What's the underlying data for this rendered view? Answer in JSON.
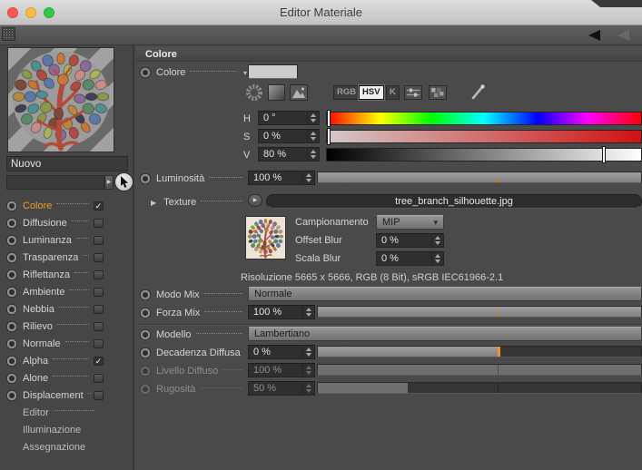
{
  "window": {
    "title": "Editor Materiale"
  },
  "icons": {
    "check": "✓",
    "dropdown_arrow": "▾",
    "disclosure": "▶",
    "play": "▶"
  },
  "colors": {
    "accent_orange": "#f09c2a",
    "traffic_red": "#fc5753",
    "traffic_yellow": "#fdbc40",
    "traffic_green": "#33c748"
  },
  "sidebar": {
    "material_name": "Nuovo",
    "channels": [
      {
        "label": "Colore",
        "check": "✓"
      },
      {
        "label": "Diffusione",
        "check": ""
      },
      {
        "label": "Luminanza",
        "check": ""
      },
      {
        "label": "Trasparenza",
        "check": ""
      },
      {
        "label": "Riflettanza",
        "check": ""
      },
      {
        "label": "Ambiente",
        "check": ""
      },
      {
        "label": "Nebbia",
        "check": ""
      },
      {
        "label": "Rilievo",
        "check": ""
      },
      {
        "label": "Normale",
        "check": ""
      },
      {
        "label": "Alpha",
        "check": "✓"
      },
      {
        "label": "Alone",
        "check": ""
      },
      {
        "label": "Displacement",
        "check": ""
      }
    ],
    "pages": [
      {
        "label": "Editor"
      },
      {
        "label": "Illuminazione"
      },
      {
        "label": "Assegnazione"
      }
    ]
  },
  "main": {
    "section_title": "Colore",
    "color": {
      "label": "Colore",
      "swatch_style": "background:#cccccc"
    },
    "mode_buttons": {
      "rgb": "RGB",
      "hsv": "HSV",
      "k": "K"
    },
    "hsv": {
      "h": {
        "label": "H",
        "value": "0 °",
        "marker_style": "left:1px"
      },
      "s": {
        "label": "S",
        "value": "0 %",
        "marker_style": "left:1px"
      },
      "v": {
        "label": "V",
        "value": "80 %",
        "marker_style": "left:88%"
      }
    },
    "brightness": {
      "label": "Luminosità",
      "value": "100 %",
      "fill_style": "width:100%",
      "tick_style": "left:55.5%"
    },
    "texture": {
      "label": "Texture",
      "file": "tree_branch_silhouette.jpg",
      "sampling": {
        "label": "Campionamento",
        "value": "MIP"
      },
      "offset_blur": {
        "label": "Offset Blur",
        "value": "0 %"
      },
      "scale_blur": {
        "label": "Scala Blur",
        "value": "0 %"
      },
      "resolution": "Risoluzione 5665 x 5666, RGB (8 Bit), sRGB IEC61966-2.1"
    },
    "mix_mode": {
      "label": "Modo Mix",
      "value": "Normale"
    },
    "mix_strength": {
      "label": "Forza Mix",
      "value": "100 %",
      "fill_style": "width:100%",
      "tick_style": "left:55.5%"
    },
    "model": {
      "label": "Modello",
      "value": "Lambertiano"
    },
    "diffuse_falloff": {
      "label": "Decadenza Diffusa",
      "value": "0 %",
      "fill_style": "width:55.5%",
      "marker_style": "left:55.5%"
    },
    "diffuse_level": {
      "label": "Livello Diffuso",
      "value": "100 %",
      "fill_style": "width:100%",
      "tick_style": "left:55.5%"
    },
    "roughness": {
      "label": "Rugosità",
      "value": "50 %",
      "fill_style": "width:27.8%",
      "tick_style": "left:55.5%"
    }
  },
  "preview": {
    "leaf_colors": [
      "#8a9a4a",
      "#4f8f8f",
      "#5b79a8",
      "#c8763a",
      "#b04a42",
      "#8a6a9a",
      "#a8b35c",
      "#c98a8a",
      "#5a8a6a",
      "#3f3f55",
      "#b5893f",
      "#7a4a3a"
    ]
  }
}
